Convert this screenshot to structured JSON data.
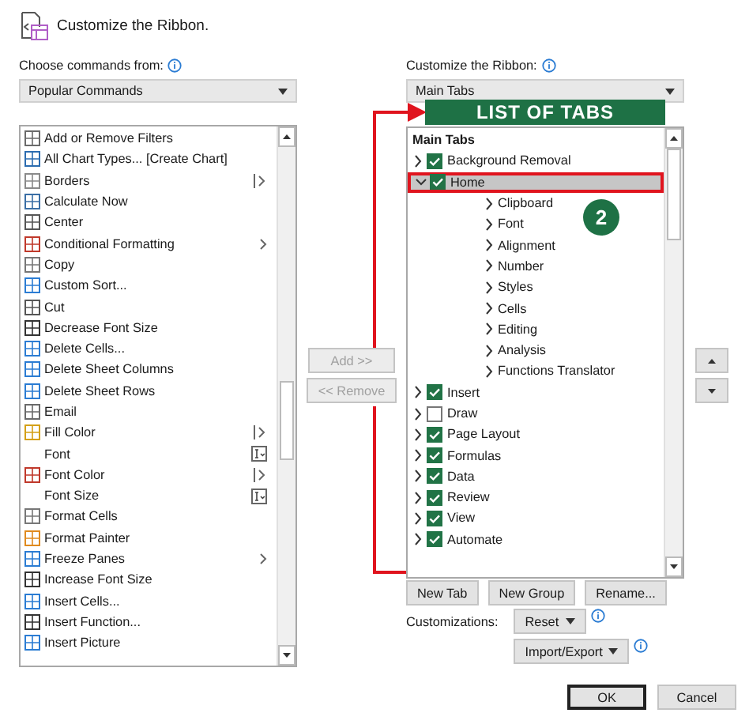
{
  "dialog": {
    "title": "Customize the Ribbon."
  },
  "commands": {
    "label": "Choose commands from:",
    "dropdown": "Popular Commands",
    "items": [
      {
        "label": "Add or Remove Filters",
        "icon": true,
        "kind": "plain"
      },
      {
        "label": "All Chart Types... [Create Chart]",
        "icon": true,
        "kind": "plain"
      },
      {
        "label": "Borders",
        "icon": true,
        "kind": "split"
      },
      {
        "label": "Calculate Now",
        "icon": true,
        "kind": "plain"
      },
      {
        "label": "Center",
        "icon": true,
        "kind": "plain"
      },
      {
        "label": "Conditional Formatting",
        "icon": true,
        "kind": "submenu"
      },
      {
        "label": "Copy",
        "icon": true,
        "kind": "plain"
      },
      {
        "label": "Custom Sort...",
        "icon": true,
        "kind": "plain"
      },
      {
        "label": "Cut",
        "icon": true,
        "kind": "plain"
      },
      {
        "label": "Decrease Font Size",
        "icon": true,
        "kind": "plain"
      },
      {
        "label": "Delete Cells...",
        "icon": true,
        "kind": "plain"
      },
      {
        "label": "Delete Sheet Columns",
        "icon": true,
        "kind": "plain"
      },
      {
        "label": "Delete Sheet Rows",
        "icon": true,
        "kind": "plain"
      },
      {
        "label": "Email",
        "icon": true,
        "kind": "plain"
      },
      {
        "label": "Fill Color",
        "icon": true,
        "kind": "split"
      },
      {
        "label": "Font",
        "icon": false,
        "kind": "fontbox"
      },
      {
        "label": "Font Color",
        "icon": true,
        "kind": "split"
      },
      {
        "label": "Font Size",
        "icon": false,
        "kind": "fontbox"
      },
      {
        "label": "Format Cells",
        "icon": true,
        "kind": "plain"
      },
      {
        "label": "Format Painter",
        "icon": true,
        "kind": "plain"
      },
      {
        "label": "Freeze Panes",
        "icon": true,
        "kind": "submenu"
      },
      {
        "label": "Increase Font Size",
        "icon": true,
        "kind": "plain"
      },
      {
        "label": "Insert Cells...",
        "icon": true,
        "kind": "plain"
      },
      {
        "label": "Insert Function...",
        "icon": true,
        "kind": "plain"
      },
      {
        "label": "Insert Picture",
        "icon": true,
        "kind": "plain"
      }
    ]
  },
  "transfer_buttons": [
    {
      "label": "Add >>",
      "disabled": true
    },
    {
      "label": "<< Remove",
      "disabled": true
    }
  ],
  "ribbon": {
    "label": "Customize the Ribbon:",
    "dropdown": "Main Tabs",
    "heading": "Main Tabs",
    "tabs": [
      {
        "label": "Background Removal",
        "checked": true,
        "expanded": false,
        "selected": false
      },
      {
        "label": "Home",
        "checked": true,
        "expanded": true,
        "selected": true,
        "children": [
          {
            "label": "Clipboard"
          },
          {
            "label": "Font"
          },
          {
            "label": "Alignment"
          },
          {
            "label": "Number"
          },
          {
            "label": "Styles"
          },
          {
            "label": "Cells"
          },
          {
            "label": "Editing"
          },
          {
            "label": "Analysis"
          },
          {
            "label": "Functions Translator"
          }
        ]
      },
      {
        "label": "Insert",
        "checked": true,
        "expanded": false,
        "selected": false
      },
      {
        "label": "Draw",
        "checked": false,
        "expanded": false,
        "selected": false
      },
      {
        "label": "Page Layout",
        "checked": true,
        "expanded": false,
        "selected": false
      },
      {
        "label": "Formulas",
        "checked": true,
        "expanded": false,
        "selected": false
      },
      {
        "label": "Data",
        "checked": true,
        "expanded": false,
        "selected": false
      },
      {
        "label": "Review",
        "checked": true,
        "expanded": false,
        "selected": false
      },
      {
        "label": "View",
        "checked": true,
        "expanded": false,
        "selected": false
      },
      {
        "label": "Automate",
        "checked": true,
        "expanded": false,
        "selected": false
      }
    ],
    "buttons": [
      "New Tab",
      "New Group",
      "Rename..."
    ],
    "customizations_label": "Customizations:",
    "reset": "Reset",
    "import_export": "Import/Export"
  },
  "footer_buttons": [
    {
      "label": "OK",
      "default": true
    },
    {
      "label": "Cancel",
      "default": false
    }
  ],
  "annotations": {
    "banner": "LIST OF TABS",
    "step": "2"
  }
}
